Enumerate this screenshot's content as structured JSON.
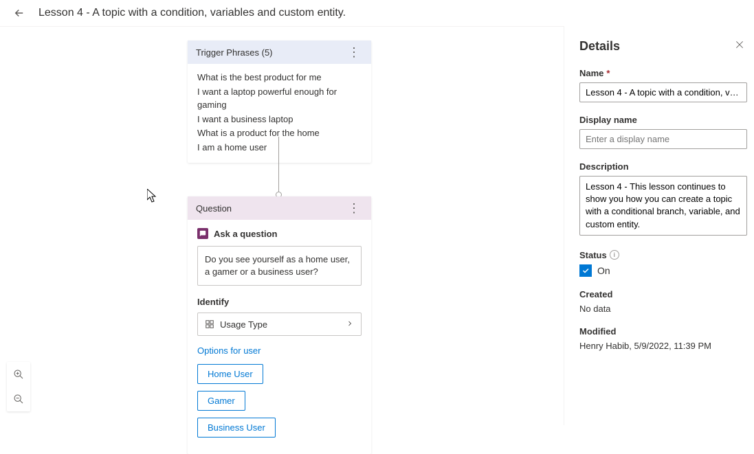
{
  "header": {
    "title": "Lesson 4 - A topic with a condition, variables and custom entity."
  },
  "trigger": {
    "title": "Trigger Phrases (5)",
    "phrases": [
      "What is the best product for me",
      "I want a laptop powerful enough for gaming",
      "I want a business laptop",
      "What is a product for the home",
      "I am a home user"
    ]
  },
  "question": {
    "title": "Question",
    "ask_label": "Ask a question",
    "text": "Do you see yourself as a home user, a gamer or a business user?",
    "identify_label": "Identify",
    "entity": "Usage Type",
    "options_label": "Options for user",
    "options": [
      "Home User",
      "Gamer",
      "Business User"
    ]
  },
  "details": {
    "title": "Details",
    "name_label": "Name",
    "name_value": "Lesson 4 - A topic with a condition, variabl...",
    "display_name_label": "Display name",
    "display_name_placeholder": "Enter a display name",
    "description_label": "Description",
    "description_value": "Lesson 4 - This lesson continues to show you how you can create a topic with a conditional branch, variable, and custom entity.",
    "status_label": "Status",
    "status_value": "On",
    "created_label": "Created",
    "created_value": "No data",
    "modified_label": "Modified",
    "modified_value": "Henry Habib, 5/9/2022, 11:39 PM"
  }
}
